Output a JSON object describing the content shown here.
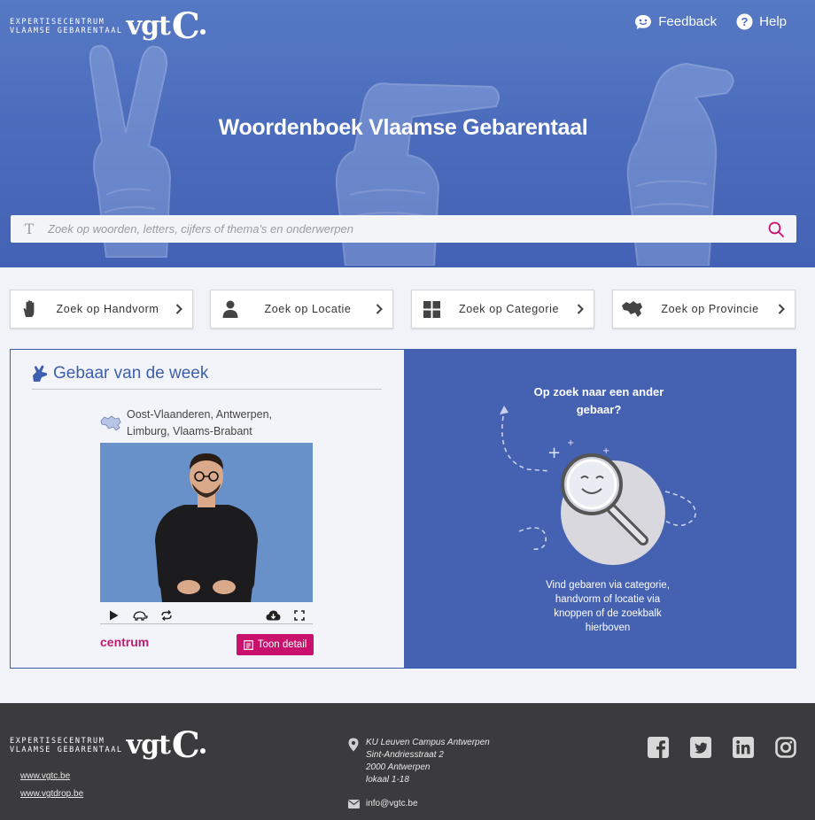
{
  "header": {
    "logo_line1": "EXPERTISECENTRUM",
    "logo_line2": "VLAAMSE GEBARENTAAL",
    "logo_vgt": "vgt",
    "logo_c": "C",
    "feedback_label": "Feedback",
    "help_label": "Help",
    "title": "Woordenboek Vlaamse Gebarentaal",
    "search_placeholder": "Zoek op woorden, letters, cijfers of thema's en onderwerpen",
    "search_value": ""
  },
  "nav": [
    {
      "label": "Zoek op Handvorm",
      "icon": "hand-icon"
    },
    {
      "label": "Zoek op Locatie",
      "icon": "person-icon"
    },
    {
      "label": "Zoek op Categorie",
      "icon": "grid-icon"
    },
    {
      "label": "Zoek op Provincie",
      "icon": "map-belgium-icon"
    }
  ],
  "week": {
    "title": "Gebaar van de week",
    "region_line1": "Oost-Vlaanderen, Antwerpen,",
    "region_line2": "Limburg, Vlaams-Brabant",
    "word": "centrum",
    "detail_label": "Toon detail"
  },
  "promo": {
    "title_line1": "Op zoek naar een ander",
    "title_line2": "gebaar?",
    "text_line1": "Vind gebaren via categorie,",
    "text_line2": "handvorm of locatie via",
    "text_line3": "knoppen of de zoekbalk",
    "text_line4": "hierboven"
  },
  "footer": {
    "link1": "www.vgtc.be",
    "link2": "www.vgtdrop.be",
    "address": [
      "KU Leuven Campus Antwerpen",
      "Sint-Andriesstraat 2",
      "2000 Antwerpen",
      "lokaal 1-18"
    ],
    "email": "info@vgtc.be",
    "social": [
      "facebook-icon",
      "twitter-icon",
      "linkedin-icon",
      "instagram-icon"
    ]
  },
  "colors": {
    "primary": "#4561b2",
    "accent": "#c8106c",
    "footer": "#3b3b3d"
  }
}
